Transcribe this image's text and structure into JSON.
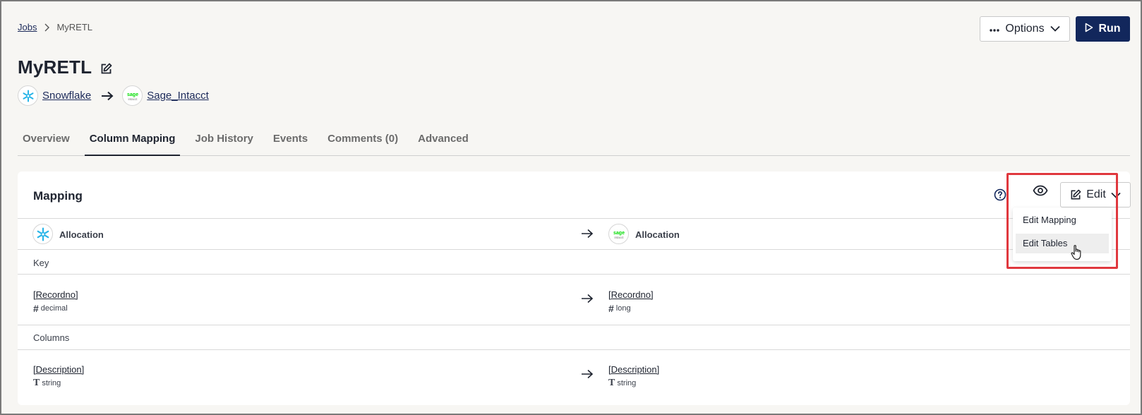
{
  "breadcrumb": {
    "root": "Jobs",
    "current": "MyRETL"
  },
  "header": {
    "options_label": "Options",
    "run_label": "Run"
  },
  "job": {
    "title": "MyRETL",
    "source": "Snowflake",
    "destination": "Sage_Intacct"
  },
  "tabs": [
    {
      "label": "Overview",
      "active": false
    },
    {
      "label": "Column Mapping",
      "active": true
    },
    {
      "label": "Job History",
      "active": false
    },
    {
      "label": "Events",
      "active": false
    },
    {
      "label": "Comments (0)",
      "active": false
    },
    {
      "label": "Advanced",
      "active": false
    }
  ],
  "mapping": {
    "title": "Mapping",
    "edit_label": "Edit",
    "menu": [
      {
        "label": "Edit Mapping"
      },
      {
        "label": "Edit Tables"
      }
    ],
    "source_table": "Allocation",
    "destination_table": "Allocation",
    "key_section": "Key",
    "columns_section": "Columns",
    "key_row": {
      "source_name": "[Recordno]",
      "source_type": "decimal",
      "source_type_icon": "hash-icon",
      "dest_name": "[Recordno]",
      "dest_type": "long",
      "dest_type_icon": "hash-icon"
    },
    "column_row": {
      "source_name": "[Description]",
      "source_type": "string",
      "source_type_icon": "text-type-icon",
      "dest_name": "[Description]",
      "dest_type": "string",
      "dest_type_icon": "text-type-icon"
    }
  },
  "sage_logo": {
    "line1": "sage",
    "line2": "intacct"
  },
  "colors": {
    "run_button": "#12275c",
    "snowflake": "#29b5e8",
    "sage": "#00dc00",
    "highlight": "#e0383e"
  }
}
